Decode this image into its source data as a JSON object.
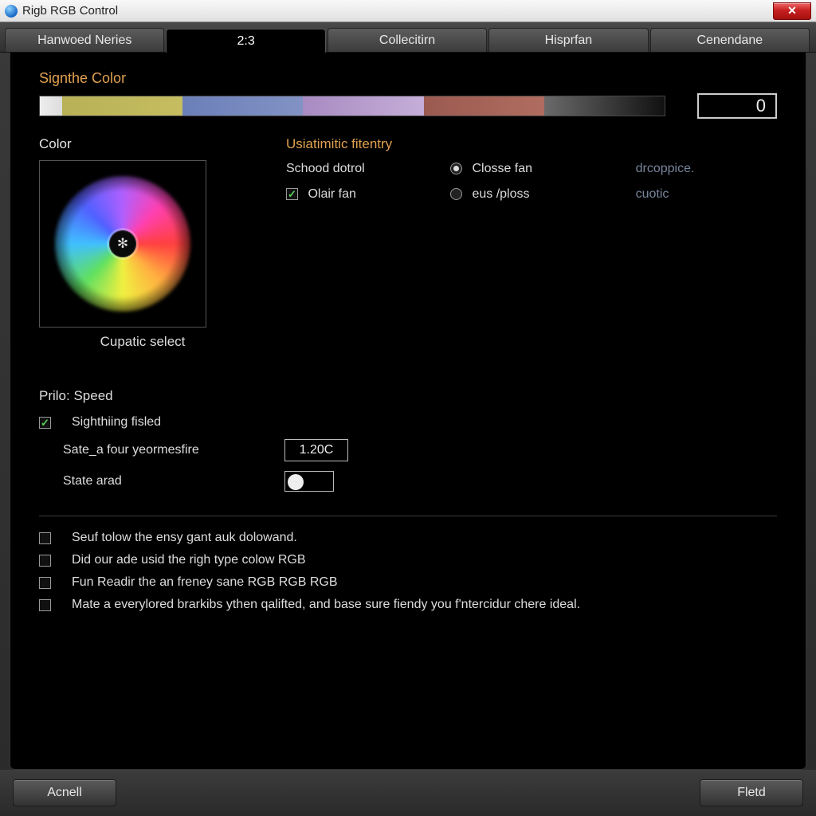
{
  "window": {
    "title": "Rigb RGB Control"
  },
  "tabs": [
    {
      "label": "Hanwoed Neries",
      "active": false
    },
    {
      "label": "2:3",
      "active": true
    },
    {
      "label": "Collecitirn",
      "active": false
    },
    {
      "label": "Hisprfan",
      "active": false
    },
    {
      "label": "Cenendane",
      "active": false
    }
  ],
  "signthe": {
    "label": "Signthe Color",
    "value": "0"
  },
  "color": {
    "label": "Color",
    "caption": "Cupatic select",
    "wheel_glyph": "✻"
  },
  "settings": {
    "title": "Usiatimitic fitentry",
    "row1_left": "Schood dotrol",
    "row1_radio": "Closse fan",
    "row1_hint": "drcoppice.",
    "row2_check": "Olair fan",
    "row2_radio": "eus /ploss",
    "row2_hint": "cuotic"
  },
  "speed": {
    "title": "Prilo: Speed",
    "main_check": "Sighthiing fisled",
    "row1_label": "Sate_a four yeormesfire",
    "row1_value": "1.20C",
    "row2_label": "State arad"
  },
  "checks": [
    "Seuf tolow the ensy gant auk dolowand.",
    "Did our ade usid the righ type colow RGB",
    "Fun Readir the an freney sane RGB RGB RGB",
    "Mate a everylored brarkibs ythen qalifted, and base sure fiendy you f'ntercidur chere ideal."
  ],
  "footer": {
    "left": "Acnell",
    "right": "Fletd"
  }
}
